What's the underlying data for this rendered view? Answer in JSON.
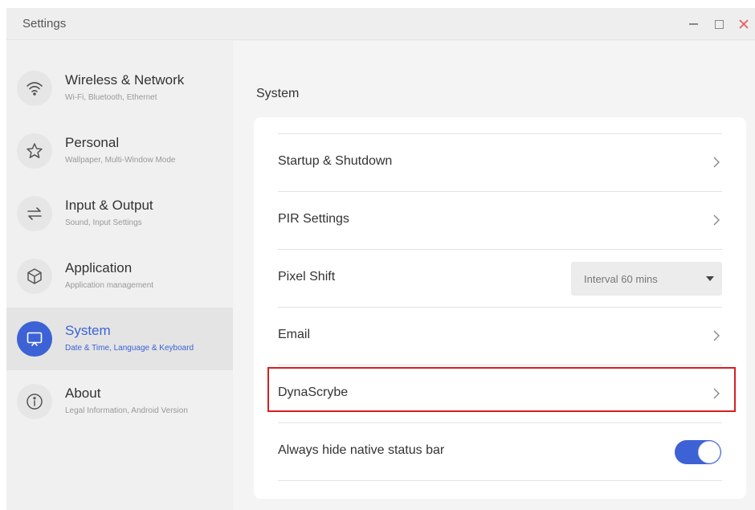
{
  "window": {
    "title": "Settings",
    "close_color": "#e05a5a"
  },
  "sidebar": {
    "items": [
      {
        "title": "Wireless & Network",
        "subtitle": "Wi-Fi, Bluetooth, Ethernet",
        "icon": "wifi-icon",
        "active": false
      },
      {
        "title": "Personal",
        "subtitle": "Wallpaper, Multi-Window Mode",
        "icon": "star-icon",
        "active": false
      },
      {
        "title": "Input & Output",
        "subtitle": "Sound, Input Settings",
        "icon": "swap-arrows-icon",
        "active": false
      },
      {
        "title": "Application",
        "subtitle": "Application management",
        "icon": "cube-icon",
        "active": false
      },
      {
        "title": "System",
        "subtitle": "Date & Time, Language & Keyboard",
        "icon": "monitor-icon",
        "active": true
      },
      {
        "title": "About",
        "subtitle": "Legal Information, Android Version",
        "icon": "info-icon",
        "active": false
      }
    ]
  },
  "main": {
    "title": "System",
    "rows": [
      {
        "label": "Startup & Shutdown",
        "control": "chevron"
      },
      {
        "label": "PIR Settings",
        "control": "chevron"
      },
      {
        "label": "Pixel Shift",
        "control": "dropdown",
        "value": "Interval 60 mins"
      },
      {
        "label": "Email",
        "control": "chevron"
      },
      {
        "label": "DynaScrybe",
        "control": "chevron",
        "highlighted": true
      },
      {
        "label": "Always hide native status bar",
        "control": "toggle",
        "on": true
      }
    ]
  },
  "colors": {
    "accent": "#3c62d6",
    "highlight_border": "#d52020"
  }
}
